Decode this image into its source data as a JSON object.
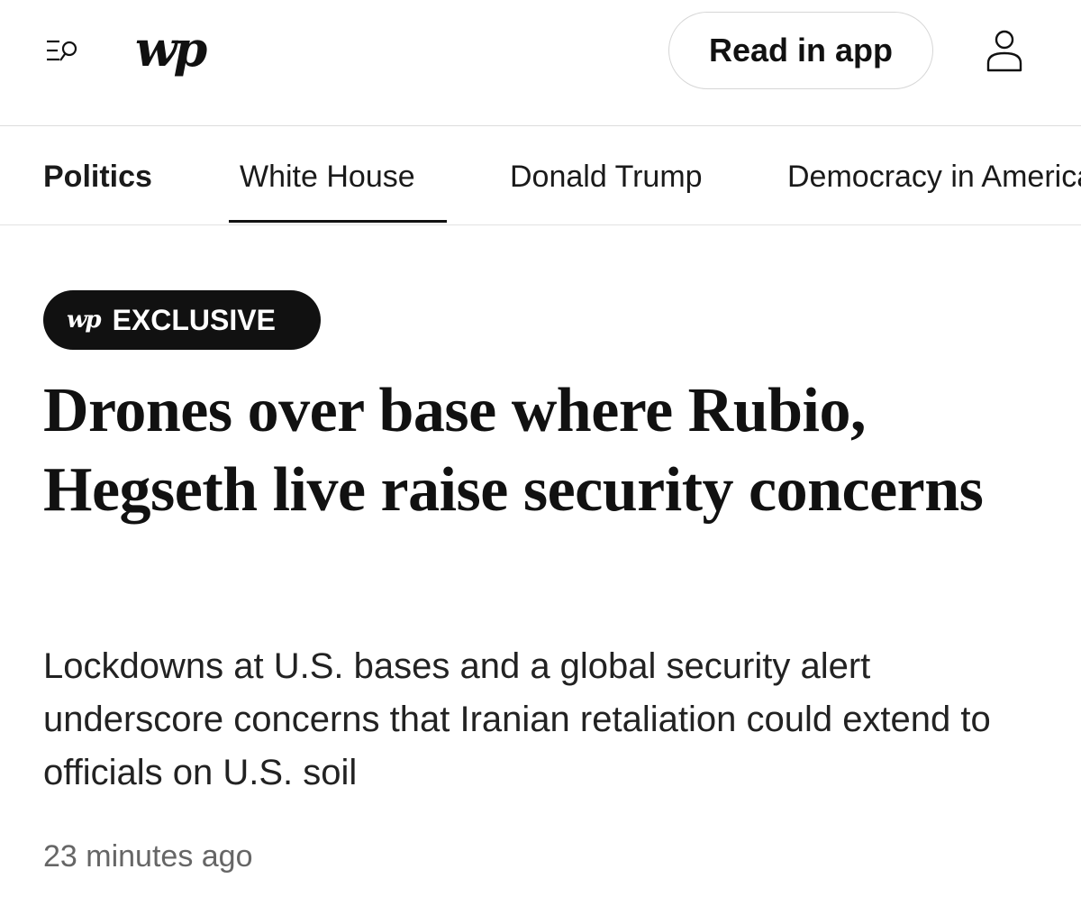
{
  "header": {
    "logo": "wp",
    "read_in_app_label": "Read in app",
    "menu_icon": "menu-search-icon",
    "profile_icon": "user-icon"
  },
  "nav": {
    "items": [
      {
        "label": "Politics"
      },
      {
        "label": "White House"
      },
      {
        "label": "Donald Trump"
      },
      {
        "label": "Democracy in America"
      }
    ]
  },
  "article": {
    "badge_logo": "wp",
    "badge_label": "EXCLUSIVE",
    "headline": "Drones over base where Rubio, Hegseth live raise security concerns",
    "dek": "Lockdowns at U.S. bases and a global security alert underscore concerns that Iranian retaliation could extend to officials on U.S. soil",
    "timestamp": "23 minutes ago"
  },
  "colors": {
    "text": "#111111",
    "badge_bg": "#111111",
    "badge_text": "#ffffff",
    "timestamp": "#666666",
    "border": "#dcdcdc"
  }
}
